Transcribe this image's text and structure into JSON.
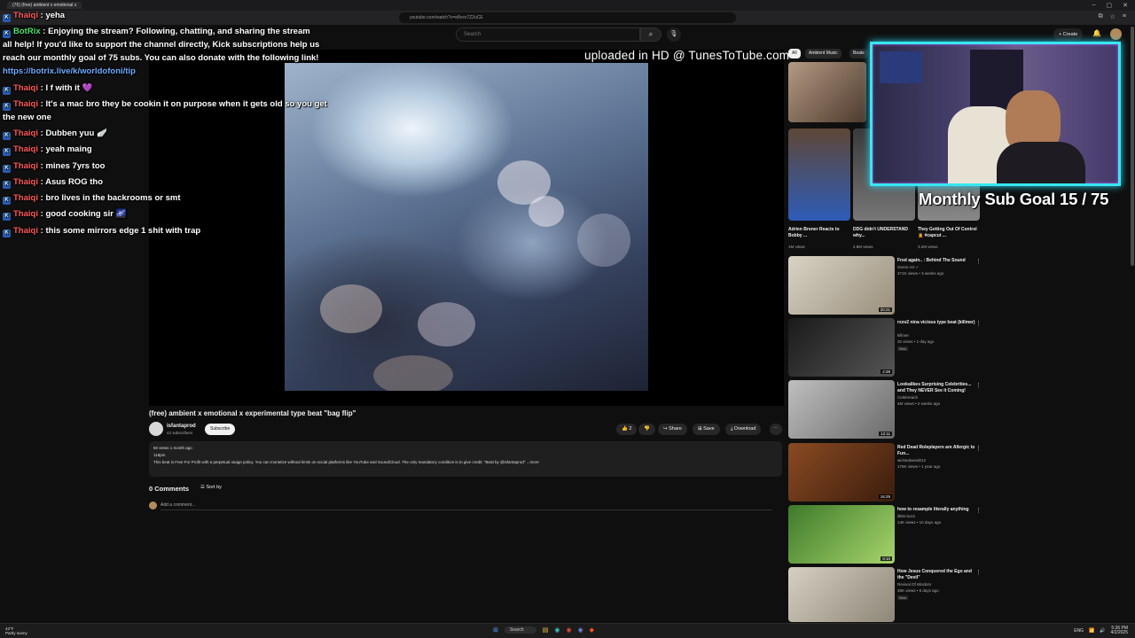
{
  "browser": {
    "tab_title": "(76) (free) ambient x emotional x",
    "url": "youtube.com/watch?v=e8vxv7Z2uCE",
    "window_buttons": [
      "–",
      "▢",
      "✕"
    ]
  },
  "yt_header": {
    "search_placeholder": "Search",
    "create_label": "+ Create"
  },
  "video": {
    "watermark": "uploaded in HD @ TunesToTube.com",
    "title": "(free) ambient x emotional x experimental type beat \"bag flip\"",
    "channel": "isfantaprod",
    "subscribers": "42 subscribers",
    "subscribe_label": "Subscribe",
    "likes": "2",
    "share_label": "Share",
    "save_label": "Save",
    "download_label": "Download",
    "stats": "50 views  1 month ago",
    "stats2": "118pm",
    "description": "This beat is Free For Profit with a perpetual usage policy. You can monetize without limits on social platforms like YouTube and SoundCloud. The only mandatory condition is to give credit: \"Beat by @isfantaprod\"",
    "more_label": "...more",
    "comments_count": "0 Comments",
    "sort_label": "Sort by",
    "add_comment_placeholder": "Add a comment..."
  },
  "chips": [
    "All",
    "Ambient Music",
    "Beats"
  ],
  "small_recs": [
    {
      "title": "Adrien Broner Reacts to Bobby ...",
      "views": "1M views",
      "color1": "#5e4636",
      "color2": "#2e5cb8"
    },
    {
      "title": "DDG didn't UNDERSTAND why...",
      "views": "4.9M views",
      "color1": "#3a3a3a",
      "color2": "#777"
    },
    {
      "title": "They Getting Out Of Control 🤦 #capcut ...",
      "views": "3.2M views",
      "color1": "#444",
      "color2": "#888"
    }
  ],
  "recs": [
    {
      "title": "Fred again.. : Behind The Sound",
      "channel": "Genre Art ✓",
      "views": "471K views • 3 weeks ago",
      "duration": "20:21",
      "badge": "",
      "c1": "#d8d3c5",
      "c2": "#9a8f7c"
    },
    {
      "title": "rxxv2 nina vicious type beat (killmer)",
      "channel": "killmer",
      "views": "32 views • 1 day ago",
      "duration": "2:39",
      "badge": "New",
      "c1": "#1a1a1a",
      "c2": "#555"
    },
    {
      "title": "Lookalikes Surprising Celebrities... and They NEVER See it Coming!",
      "channel": "Celebreach",
      "views": "4M views • 2 weeks ago",
      "duration": "12:11",
      "badge": "",
      "c1": "#bfbfbf",
      "c2": "#6a6a6a"
    },
    {
      "title": "Red Dead Roleplayers are Allergic to Fun...",
      "channel": "wickedweed012",
      "views": "176K views • 1 year ago",
      "duration": "16:29",
      "badge": "",
      "c1": "#8a4a22",
      "c2": "#3b1d0d"
    },
    {
      "title": "how to resample literally anything",
      "channel": "littler.box1",
      "views": "14K views • 10 days ago",
      "duration": "9:10",
      "badge": "",
      "c1": "#3d7a2a",
      "c2": "#a7d46b"
    },
    {
      "title": "How Jesus Conquered the Ego and the \"Devil\"",
      "channel": "Revival Of Wisdom",
      "views": "39K views • 5 days ago",
      "duration": "",
      "badge": "New",
      "c1": "#d6d0c2",
      "c2": "#8e8677"
    }
  ],
  "stream": {
    "sub_goal": "Monthly Sub Goal 15 / 75",
    "chat": [
      {
        "user": "Thaiqi",
        "msg": "yeha"
      },
      {
        "user": "BotRix",
        "msg": "Enjoying the stream? Following, chatting, and sharing the stream",
        "bot": true
      },
      {
        "wrap": "all help! If you'd like to support the channel directly, Kick subscriptions help us"
      },
      {
        "wrap": "reach our monthly goal of 75 subs. You can also donate with the following link!"
      },
      {
        "link": "https://botrix.live/k/worldofoni/tip"
      },
      {
        "user": "Thaiqi",
        "msg": "I f with it 💜"
      },
      {
        "user": "Thaiqi",
        "msg": "It's a mac bro they be cookin it on purpose when it gets old so you get"
      },
      {
        "wrap": "the new one"
      },
      {
        "user": "Thaiqi",
        "msg": "Dubben yuu 🪽"
      },
      {
        "user": "Thaiqi",
        "msg": "yeah maing"
      },
      {
        "user": "Thaiqi",
        "msg": "mines 7yrs too"
      },
      {
        "user": "Thaiqi",
        "msg": "Asus ROG tho"
      },
      {
        "user": "Thaiqi",
        "msg": "bro lives in the backrooms or smt"
      },
      {
        "user": "Thaiqi",
        "msg": "good cooking sir 🌌"
      },
      {
        "user": "Thaiqi",
        "msg": "this some mirrors edge 1 shit with trap"
      }
    ]
  },
  "taskbar": {
    "weather_temp": "43°F",
    "weather_desc": "Partly sunny",
    "search_label": "Search",
    "lang": "ENG",
    "time": "5:36 PM",
    "date": "4/2/2025"
  }
}
